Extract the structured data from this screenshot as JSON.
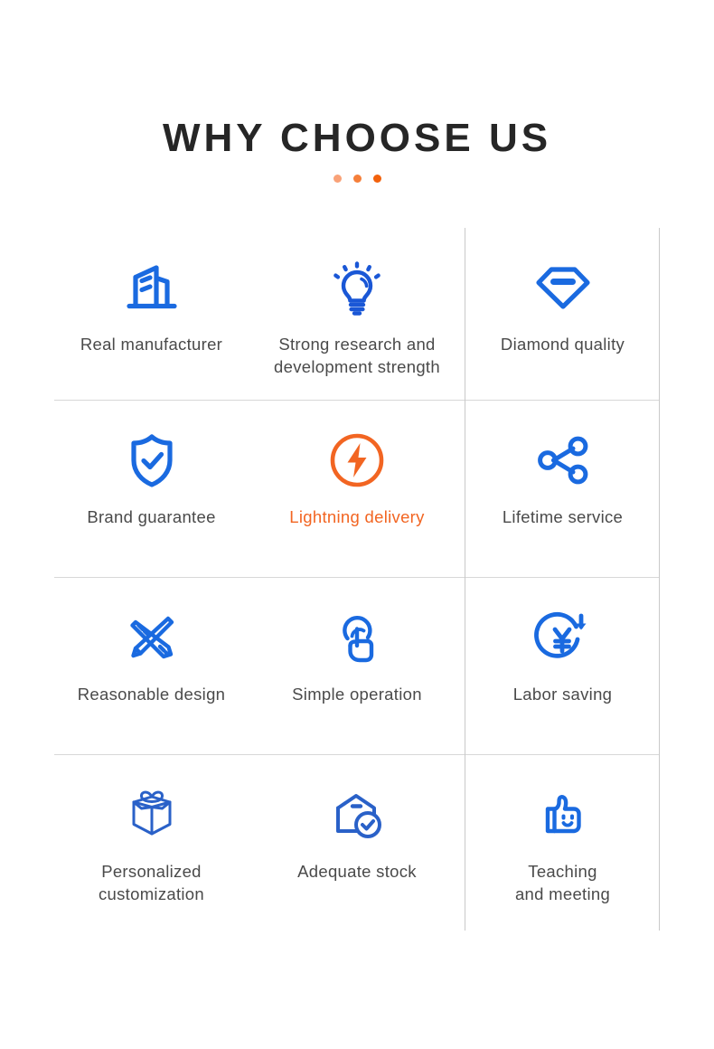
{
  "header": {
    "title": "WHY CHOOSE US"
  },
  "decor": {
    "dots": [
      {
        "name": "dot-1",
        "color": "#f9a278"
      },
      {
        "name": "dot-2",
        "color": "#f57f3a"
      },
      {
        "name": "dot-3",
        "color": "#f2610c"
      }
    ]
  },
  "theme": {
    "brand_blue": "#1a6ae0",
    "brand_blue_dark": "#1b55c4",
    "accent_orange": "#f26522",
    "text_gray": "#4a4a4a",
    "title_black": "#262626",
    "divider_gray": "#d7d7d7"
  },
  "features": [
    {
      "id": "real-manufacturer",
      "label": "Real manufacturer",
      "icon": "factory-building-icon",
      "color": "#1a6ae0",
      "accent": false
    },
    {
      "id": "strong-research-and-development-strength",
      "label": "Strong research and\ndevelopment strength",
      "icon": "lightbulb-idea-icon",
      "color": "#1a57d6",
      "accent": false
    },
    {
      "id": "diamond-quality",
      "label": "Diamond quality",
      "icon": "diamond-gem-icon",
      "color": "#1a6ae0",
      "accent": false
    },
    {
      "id": "brand-guarantee",
      "label": "Brand guarantee",
      "icon": "shield-check-icon",
      "color": "#1a6ae0",
      "accent": false
    },
    {
      "id": "lightning-delivery",
      "label": "Lightning delivery",
      "icon": "lightning-bolt-circle-icon",
      "color": "#f26522",
      "accent": true
    },
    {
      "id": "lifetime-service",
      "label": "Lifetime service",
      "icon": "share-network-icon",
      "color": "#1a6ae0",
      "accent": false
    },
    {
      "id": "reasonable-design",
      "label": "Reasonable design",
      "icon": "pencil-ruler-icon",
      "color": "#1a6ae0",
      "accent": false
    },
    {
      "id": "simple-operation",
      "label": "Simple operation",
      "icon": "touch-tap-hand-icon",
      "color": "#1a6ae0",
      "accent": false
    },
    {
      "id": "labor-saving",
      "label": "Labor saving",
      "icon": "yen-savings-arrow-icon",
      "color": "#1a6ae0",
      "accent": false
    },
    {
      "id": "personalized-customization",
      "label": "Personalized\ncustomization",
      "icon": "gift-box-icon",
      "color": "#2a61c8",
      "accent": false
    },
    {
      "id": "adequate-stock",
      "label": "Adequate stock",
      "icon": "warehouse-check-icon",
      "color": "#2a61c8",
      "accent": false
    },
    {
      "id": "teaching-and-meeting",
      "label": "Teaching\nand meeting",
      "icon": "thumbs-up-smile-icon",
      "color": "#1a6ae0",
      "accent": false
    }
  ]
}
